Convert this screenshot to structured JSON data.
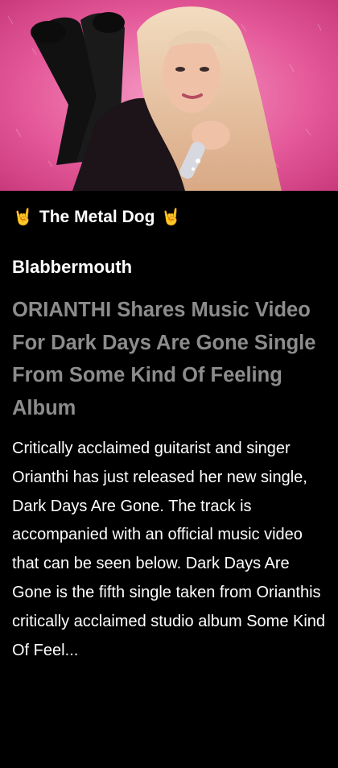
{
  "hero": {
    "image_name": "article-hero-image",
    "colors": {
      "background": "#e64d93",
      "hair": "#e8c9a8",
      "boots": "#111111"
    }
  },
  "site": {
    "name": "The Metal Dog",
    "emoji_left": "🤘",
    "emoji_right": "🤘"
  },
  "article": {
    "source": "Blabbermouth",
    "headline": "ORIANTHI Shares Music Video For Dark Days Are Gone Single From Some Kind Of Feeling Album",
    "excerpt": "Critically acclaimed guitarist and singer Orianthi has just released her new single, Dark Days Are Gone. The track is accompanied with an official music video that can be seen below. Dark Days Are Gone is the fifth single taken from Orianthis critically acclaimed studio album Some Kind Of Feel..."
  },
  "theme": {
    "background": "#000000",
    "text": "#ffffff",
    "headline": "#8c8c8c"
  }
}
